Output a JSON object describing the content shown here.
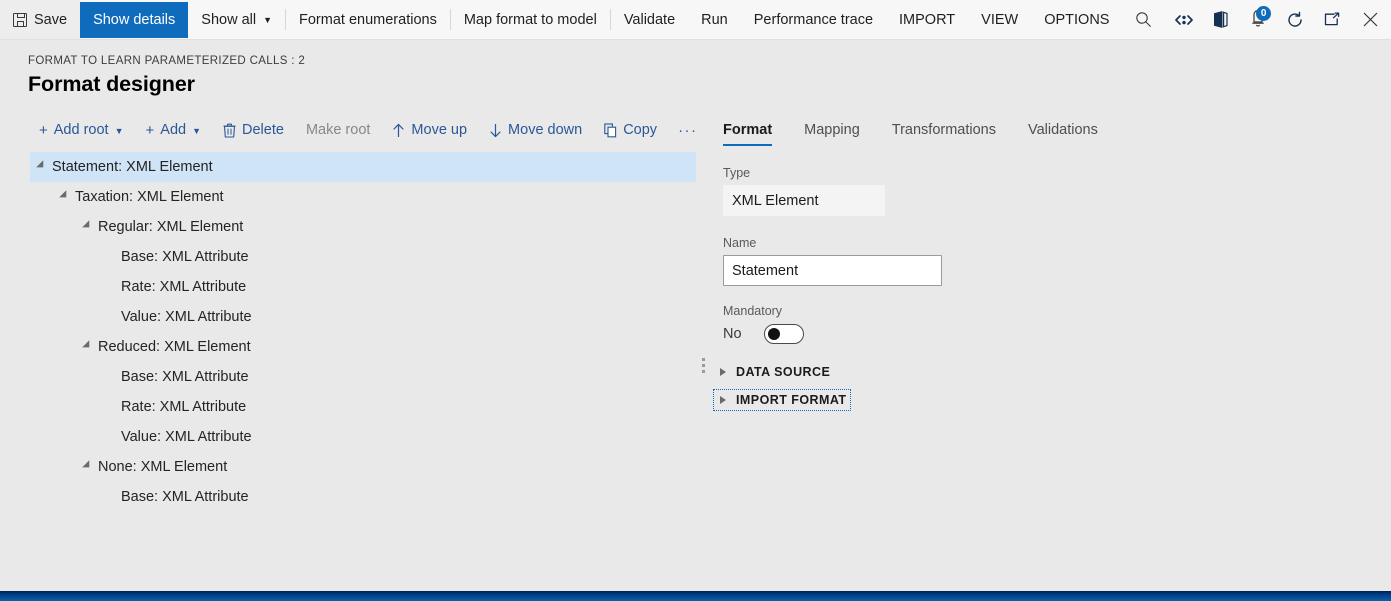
{
  "topbar": {
    "items": [
      {
        "id": "save",
        "label": "Save",
        "icon": "save-icon",
        "type": "icon-text"
      },
      {
        "id": "show-details",
        "label": "Show details",
        "icon": null,
        "type": "active"
      },
      {
        "id": "show-all",
        "label": "Show all",
        "icon": "chevron-down-icon",
        "type": "caret"
      },
      {
        "id": "sep1",
        "label": "",
        "icon": null,
        "type": "separator"
      },
      {
        "id": "format-enumerations",
        "label": "Format enumerations",
        "icon": null,
        "type": "text"
      },
      {
        "id": "sep2",
        "label": "",
        "icon": null,
        "type": "separator"
      },
      {
        "id": "map-format-to-model",
        "label": "Map format to model",
        "icon": null,
        "type": "text"
      },
      {
        "id": "sep3",
        "label": "",
        "icon": null,
        "type": "separator"
      },
      {
        "id": "validate",
        "label": "Validate",
        "icon": null,
        "type": "text"
      },
      {
        "id": "run",
        "label": "Run",
        "icon": null,
        "type": "text"
      },
      {
        "id": "performance-trace",
        "label": "Performance trace",
        "icon": null,
        "type": "text"
      },
      {
        "id": "import",
        "label": "IMPORT",
        "icon": null,
        "type": "text"
      },
      {
        "id": "view",
        "label": "VIEW",
        "icon": null,
        "type": "text"
      },
      {
        "id": "options",
        "label": "OPTIONS",
        "icon": null,
        "type": "text"
      }
    ],
    "search_icon": "search-icon",
    "right_icons": [
      {
        "id": "accessibility",
        "icon": "accessibility-icon",
        "badge": null
      },
      {
        "id": "office-app",
        "icon": "office-logo-icon",
        "badge": null
      },
      {
        "id": "notifications",
        "icon": "notification-icon",
        "badge": "0"
      },
      {
        "id": "refresh",
        "icon": "refresh-icon",
        "badge": null
      },
      {
        "id": "popout",
        "icon": "open-in-new-icon",
        "badge": null
      },
      {
        "id": "close",
        "icon": "close-icon",
        "badge": null
      }
    ]
  },
  "header": {
    "breadcrumb": "FORMAT TO LEARN PARAMETERIZED CALLS : 2",
    "title": "Format designer"
  },
  "actionbar": {
    "actions": [
      {
        "id": "add-root",
        "label": "Add root",
        "icon": "plus-icon",
        "caret": true,
        "disabled": false
      },
      {
        "id": "add",
        "label": "Add",
        "icon": "plus-icon",
        "caret": true,
        "disabled": false
      },
      {
        "id": "delete",
        "label": "Delete",
        "icon": "trash-icon",
        "caret": false,
        "disabled": false
      },
      {
        "id": "make-root",
        "label": "Make root",
        "icon": null,
        "caret": false,
        "disabled": true
      },
      {
        "id": "move-up",
        "label": "Move up",
        "icon": "arrow-up-icon",
        "caret": false,
        "disabled": false
      },
      {
        "id": "move-down",
        "label": "Move down",
        "icon": "arrow-down-icon",
        "caret": false,
        "disabled": false
      },
      {
        "id": "copy",
        "label": "Copy",
        "icon": "copy-icon",
        "caret": false,
        "disabled": false
      }
    ],
    "overflow_label": "···"
  },
  "tree": {
    "nodes": [
      {
        "label": "Statement: XML Element",
        "depth": 0,
        "expandable": true,
        "selected": true
      },
      {
        "label": "Taxation: XML Element",
        "depth": 1,
        "expandable": true,
        "selected": false
      },
      {
        "label": "Regular: XML Element",
        "depth": 2,
        "expandable": true,
        "selected": false
      },
      {
        "label": "Base: XML Attribute",
        "depth": 3,
        "expandable": false,
        "selected": false
      },
      {
        "label": "Rate: XML Attribute",
        "depth": 3,
        "expandable": false,
        "selected": false
      },
      {
        "label": "Value: XML Attribute",
        "depth": 3,
        "expandable": false,
        "selected": false
      },
      {
        "label": "Reduced: XML Element",
        "depth": 2,
        "expandable": true,
        "selected": false
      },
      {
        "label": "Base: XML Attribute",
        "depth": 3,
        "expandable": false,
        "selected": false
      },
      {
        "label": "Rate: XML Attribute",
        "depth": 3,
        "expandable": false,
        "selected": false
      },
      {
        "label": "Value: XML Attribute",
        "depth": 3,
        "expandable": false,
        "selected": false
      },
      {
        "label": "None: XML Element",
        "depth": 2,
        "expandable": true,
        "selected": false
      },
      {
        "label": "Base: XML Attribute",
        "depth": 3,
        "expandable": false,
        "selected": false
      }
    ]
  },
  "details": {
    "tabs": [
      {
        "id": "format",
        "label": "Format",
        "active": true
      },
      {
        "id": "mapping",
        "label": "Mapping",
        "active": false
      },
      {
        "id": "transformations",
        "label": "Transformations",
        "active": false
      },
      {
        "id": "validations",
        "label": "Validations",
        "active": false
      }
    ],
    "type": {
      "label": "Type",
      "value": "XML Element",
      "readonly": true
    },
    "name": {
      "label": "Name",
      "value": "Statement",
      "placeholder": ""
    },
    "mandatory": {
      "label": "Mandatory",
      "value": "No",
      "checked": false
    },
    "expanders": [
      {
        "id": "data-source",
        "label": "DATA SOURCE",
        "expanded": false,
        "focused": false
      },
      {
        "id": "import-format",
        "label": "IMPORT FORMAT",
        "expanded": false,
        "focused": true
      }
    ]
  },
  "colors": {
    "accent": "#0f6cbd",
    "page_bg": "#e9e9e9",
    "topbar_bg": "#f7f7f7",
    "selection": "#cfe4f7",
    "link": "#2b5797",
    "bottom_bar": "#00448f"
  }
}
